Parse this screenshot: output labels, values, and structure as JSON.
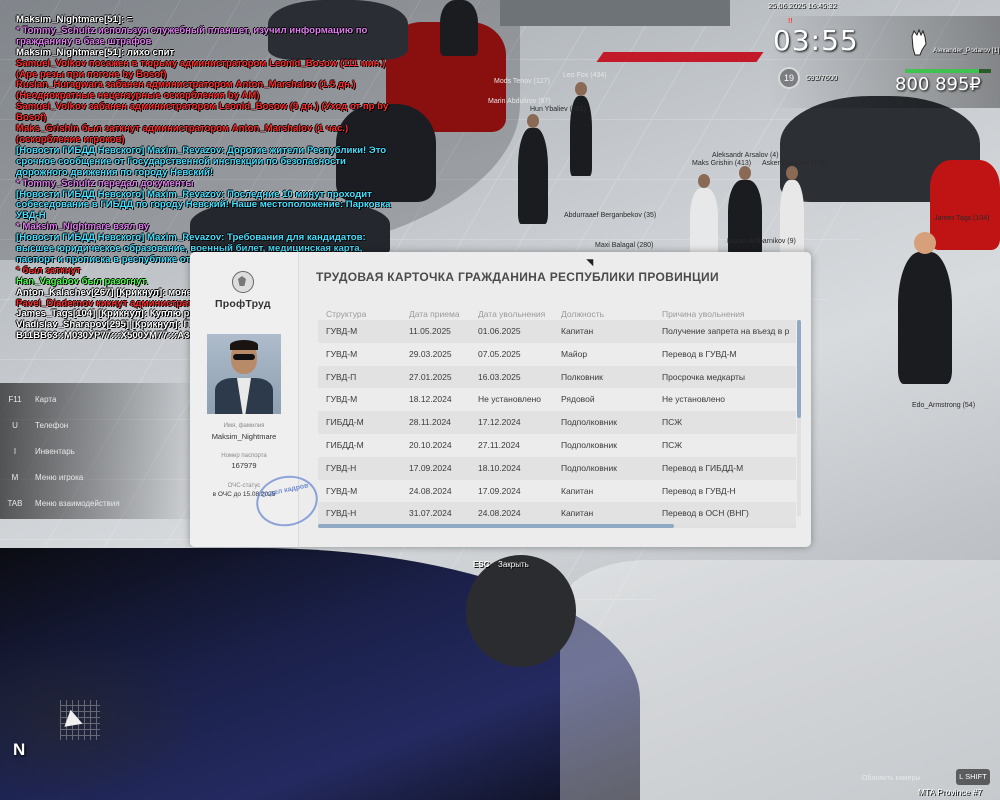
{
  "datetime": "25.06.2025 16:45:32",
  "hud": {
    "clock": "03:55",
    "player_name": "Alexander_Podarov [1]",
    "level": "19",
    "experience": "593/7600",
    "money": "800 895₽",
    "colors": {
      "money_bar": "#3fc24f",
      "clock": "#ffffff"
    }
  },
  "chat": [
    {
      "text": "Maksim_Nightmare[51]: =",
      "color": "#ffffff"
    },
    {
      "text": "* Tommy_Schultz используя служебный планшет, изучил информацию по гражданину в базе штрафов",
      "color": "#e07cf0"
    },
    {
      "text": "Maksim_Nightmare[51]: лихо спит",
      "color": "#ffffff"
    },
    {
      "text": "Samuel_Volkov посажен в тюрьму администратором Leonid_Bosow (111 мин.) (Аре резы при погоне by Bosof)",
      "color": "#ff2a2a"
    },
    {
      "text": "Ruslan_Huragwara забанен администратором Anton_Marshalov (1.5 дн.) (Неоднократные нецензурные оскорбления by AM)",
      "color": "#ff2a2a"
    },
    {
      "text": "Samuel_Volkov забанен администратором Leonid_Bosow (9 дн.) (Уход от пр by Bosof)",
      "color": "#ff2a2a"
    },
    {
      "text": "Maks_Grishin был заткнут администратором Anton_Marshalov (1 час.) (оскорбление игроков)",
      "color": "#ff2a2a"
    },
    {
      "text": "[Новости ГИБДД Невского] Maxim_Revazov: Дорогие жители Республики! Это срочное сообщение от Государственной инспекции по безопасности дорожного движения по городу Невский!",
      "color": "#44e0ff"
    },
    {
      "text": "* Tommy_Schultz передал документы",
      "color": "#e07cf0"
    },
    {
      "text": "[Новости ГИБДД Невского] Maxim_Revazov: Последние 10 минут проходит собеседование в ГИБДД по городу Невский! Наше местоположение: Парковка УВД-Н",
      "color": "#44e0ff"
    },
    {
      "text": "* Maksim_Nightmare взял ву",
      "color": "#e07cf0"
    },
    {
      "text": "[Новости ГИБДД Невского] Maxim_Revazov: Требования для кандидатов:  высшее юридическое образование, военный билет, медицинская карта, паспорт и прописка в республике от 5 лет.",
      "color": "#44e0ff"
    },
    {
      "text": "* был заткнут",
      "color": "#ff2a2a"
    },
    {
      "text": "Han_Vagabov был разогнут.",
      "color": "#4cff4c"
    },
    {
      "text": "Anton_Kalachev[267] [Крикнул]: монетка 48к фаст",
      "color": "#ffffff"
    },
    {
      "text": "Pavel_Diadernov кикнут администратором Miavel_Volkov (AFK 30+)",
      "color": "#ff2a2a"
    },
    {
      "text": "James_Tags[104] [Крикнул]: Куплю рюкзак Balmain черный",
      "color": "#ffffff"
    },
    {
      "text": "Vladislav_Sharapov[295] [Крикнул]: Продам В11ВВ63::М030УР77:::Х500УМ77:::А333МО78:::А008МО78:::О060ОО77",
      "color": "#ffffff"
    }
  ],
  "keymenu": [
    {
      "key": "F11",
      "label": "Карта"
    },
    {
      "key": "U",
      "label": "Телефон"
    },
    {
      "key": "I",
      "label": "Инвентарь"
    },
    {
      "key": "M",
      "label": "Меню игрока"
    },
    {
      "key": "TAB",
      "label": "Меню взаимодействия"
    }
  ],
  "minimap": {
    "compass": "N"
  },
  "nametags": [
    "Mods Tenov (127)",
    "Leo Fox (434)",
    "Marin Abdulirov (67)",
    "Hun Ybaliev (391)",
    "Edo Armstrong (54)",
    "Aleksandr Arsalov (4)",
    "Maks Grishin (413)",
    "Asker Gazaliev (173)",
    "Abdurraaef Berganbekov (35)",
    "Lazarr Ambarnikov (9)",
    "Maxi Balagal (280)",
    "James Tags (104)",
    "Edo_Armstrong (54)"
  ],
  "card": {
    "logo": "ПрофТруд",
    "title": "ТРУДОВАЯ КАРТОЧКА ГРАЖДАНИНА РЕСПУБЛИКИ ПРОВИНЦИИ",
    "name_label": "Имя, фамилия",
    "name_value": "Maksim_Nightmare",
    "passport_label": "Номер паспорта",
    "passport_value": "167979",
    "status_label": "ОЧС-статус",
    "status_value": "в ОЧС до 15.08.2025",
    "stamp_text": "Отдел кадров",
    "columns": [
      "Структура",
      "Дата приема",
      "Дата увольнения",
      "Должность",
      "Причина увольнения"
    ],
    "rows": [
      [
        "ГУВД-М",
        "11.05.2025",
        "01.06.2025",
        "Капитан",
        "Получение запрета на въезд в р"
      ],
      [
        "ГУВД-М",
        "29.03.2025",
        "07.05.2025",
        "Майор",
        "Перевод в ГУВД-М"
      ],
      [
        "ГУВД-П",
        "27.01.2025",
        "16.03.2025",
        "Полковник",
        "Просрочка медкарты"
      ],
      [
        "ГУВД-М",
        "18.12.2024",
        "Не установлено",
        "Рядовой",
        "Не установлено"
      ],
      [
        "ГИБДД-М",
        "28.11.2024",
        "17.12.2024",
        "Подполковник",
        "ПСЖ"
      ],
      [
        "ГИБДД-М",
        "20.10.2024",
        "27.11.2024",
        "Подполковник",
        "ПСЖ"
      ],
      [
        "ГУВД-Н",
        "17.09.2024",
        "18.10.2024",
        "Подполковник",
        "Перевод в ГИБДД-М"
      ],
      [
        "ГУВД-М",
        "24.08.2024",
        "17.09.2024",
        "Капитан",
        "Перевод в ГУВД-Н"
      ],
      [
        "ГУВД-Н",
        "31.07.2024",
        "24.08.2024",
        "Капитан",
        "Перевод в ОСН (ВНГ)"
      ]
    ],
    "esc_key": "ESC",
    "close_label": "Закрыть"
  },
  "footer": {
    "lshift": "L SHIFT",
    "server": "MTA Province #7",
    "faded_hint": "Обновить камеры"
  }
}
